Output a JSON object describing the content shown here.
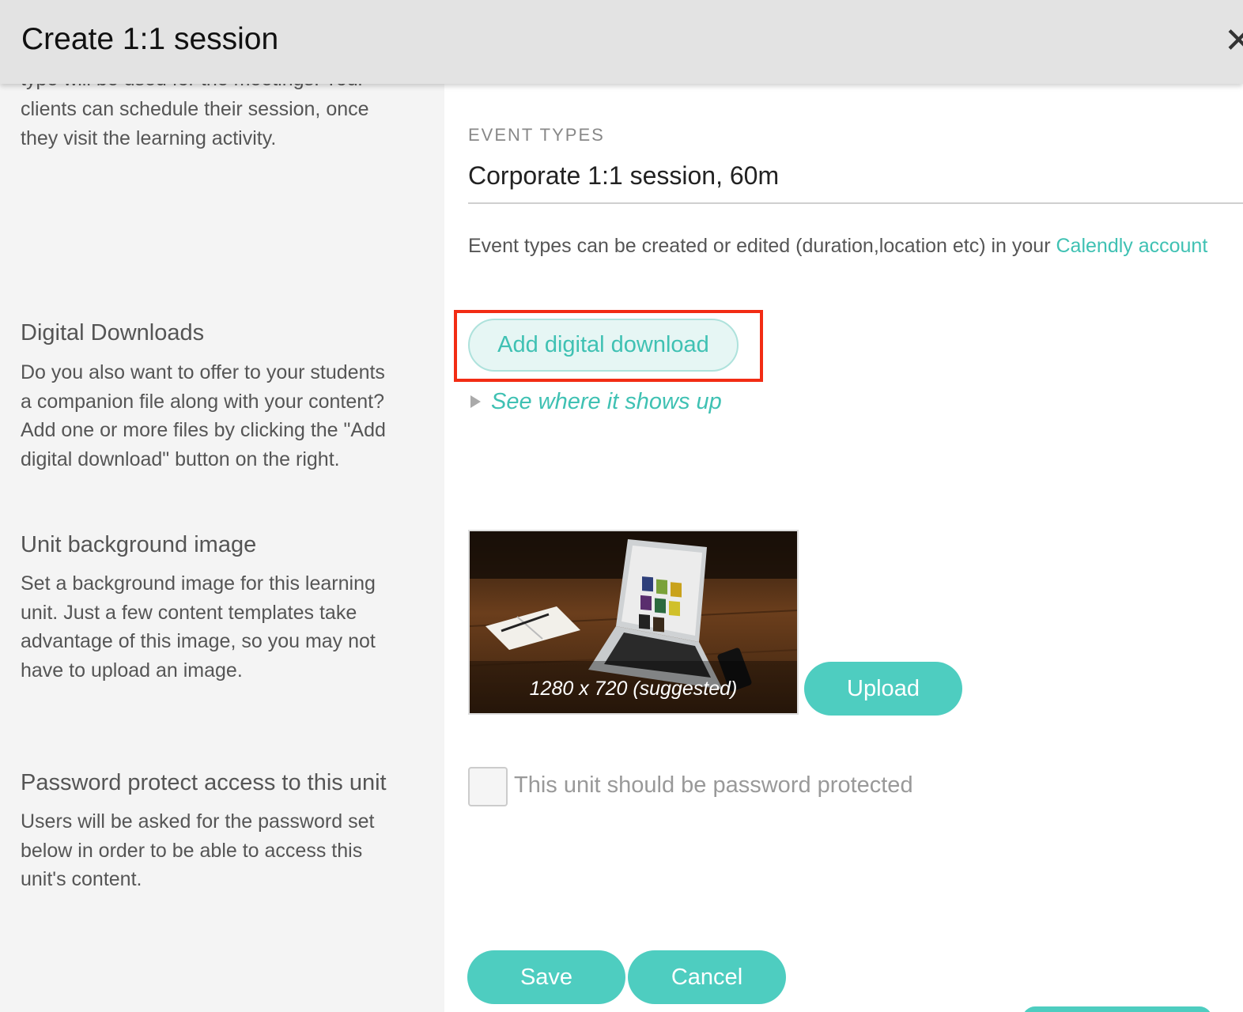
{
  "header": {
    "title": "Create 1:1 session",
    "close_icon": "close-icon"
  },
  "intro": {
    "clipped_line": "type will be used for the meetings. Your",
    "lines": [
      "clients can schedule their session, once",
      "they visit the learning activity."
    ]
  },
  "event_types": {
    "label": "EVENT TYPES",
    "value": "Corporate 1:1 session, 60m",
    "help_text": "Event types can be created or edited (duration,location etc) in your",
    "link_text": "Calendly account"
  },
  "digital_downloads": {
    "heading": "Digital Downloads",
    "description_lines": [
      "Do you also want to offer to your students",
      "a companion file along with your content?",
      "Add one or more files by clicking the \"Add",
      "digital download\" button on the right."
    ],
    "add_button": "Add digital download",
    "see_where_link": "See where it shows up"
  },
  "background_image": {
    "heading": "Unit background image",
    "description_lines": [
      "Set a background image for this learning",
      "unit. Just a few content templates take",
      "advantage of this image, so you may not",
      "have to upload an image."
    ],
    "caption": "1280 x 720 (suggested)",
    "upload_button": "Upload"
  },
  "password": {
    "heading": "Password protect access to this unit",
    "description_lines": [
      "Users will be asked for the password set",
      "below in order to be able to access this",
      "unit's content."
    ],
    "checkbox_label": "This unit should be password protected",
    "checked": false
  },
  "footer": {
    "save": "Save",
    "cancel": "Cancel"
  },
  "colors": {
    "accent": "#4ecdc0",
    "link": "#3fc1b3",
    "highlight": "#f22c14",
    "header_bg": "#e3e3e3",
    "left_panel_bg": "#f4f4f4"
  }
}
